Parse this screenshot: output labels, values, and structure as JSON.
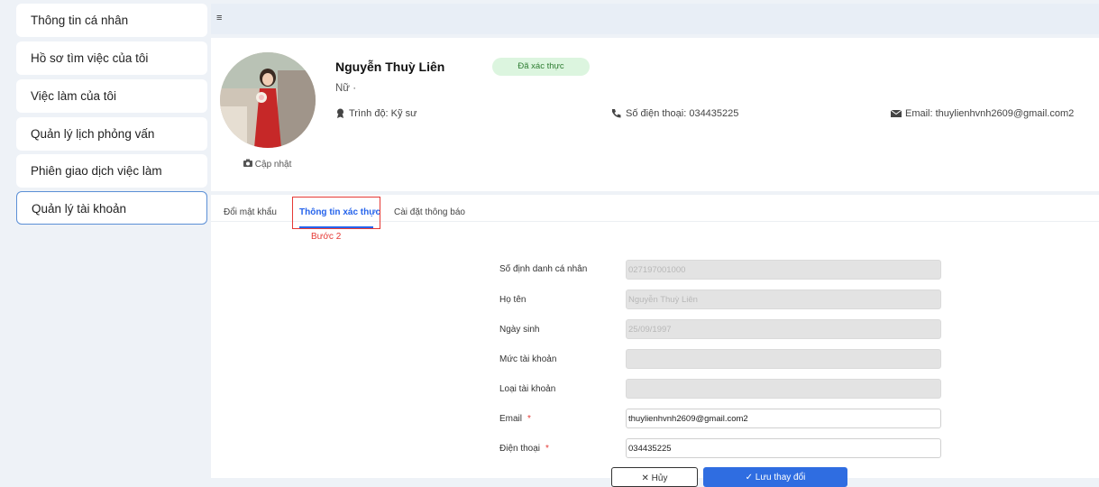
{
  "sidebar": {
    "items": [
      {
        "label": "Thông tin cá nhân"
      },
      {
        "label": "Hồ sơ tìm việc của tôi"
      },
      {
        "label": "Việc làm của tôi"
      },
      {
        "label": "Quản lý lịch phỏng vấn"
      },
      {
        "label": "Phiên giao dịch việc làm"
      },
      {
        "label": "Quản lý tài khoản"
      }
    ]
  },
  "topbar": {
    "menu_glyph": "≡"
  },
  "profile": {
    "name": "Nguyễn Thuỳ Liên",
    "badge": "Đã xác thực",
    "gender": "Nữ ·",
    "education": "Trình độ: Kỹ sư",
    "phone": "Số điện thoại: 034435225",
    "email": "Email: thuylienhvnh2609@gmail.com2",
    "update_label": "Cập nhật"
  },
  "tabs": [
    {
      "label": "Đổi mật khẩu"
    },
    {
      "label": "Thông tin xác thực"
    },
    {
      "label": "Cài đặt thông báo"
    }
  ],
  "annotation": {
    "step": "Bước 2"
  },
  "form": {
    "fields": [
      {
        "label": "Số định danh cá nhân",
        "value": "027197001000"
      },
      {
        "label": "Họ tên",
        "value": "Nguyễn Thuỳ Liên"
      },
      {
        "label": "Ngày sinh",
        "value": "25/09/1997"
      },
      {
        "label": "Mức tài khoản",
        "value": ""
      },
      {
        "label": "Loại tài khoản",
        "value": ""
      },
      {
        "label": "Email",
        "value": "thuylienhvnh2609@gmail.com2",
        "required": "*"
      },
      {
        "label": "Điện thoại",
        "value": "034435225",
        "required": "*"
      }
    ],
    "cancel_label": "✕  Hủy",
    "save_label": "✓  Lưu thay đổi"
  },
  "colors": {
    "accent": "#2f6de1",
    "verified_bg": "#dcf5df",
    "highlight": "#e53935"
  }
}
